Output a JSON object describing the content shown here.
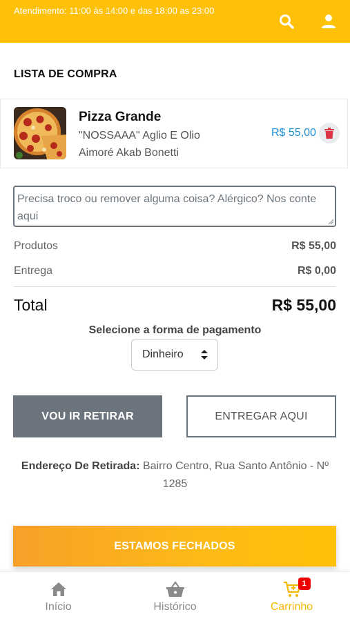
{
  "header": {
    "hours": "Atendimento: 11:00 às 14:00 e das 18:00 as 23:00",
    "search_icon": "search-icon",
    "user_icon": "user-icon",
    "bg_color": "#ffc107"
  },
  "cart": {
    "title": "LISTA DE COMPRA",
    "items": [
      {
        "name": "Pizza Grande",
        "description": "\"NOSSAAA\" Aglio E Olio Aimoré Akab Bonetti",
        "price": "R$ 55,00",
        "image": "pizza-thumbnail",
        "delete_icon": "trash-icon"
      }
    ]
  },
  "notes": {
    "placeholder": "Precisa troco ou remover alguma coisa? Alérgico? Nos conte aqui"
  },
  "summary": {
    "products_label": "Produtos",
    "products_value": "R$ 55,00",
    "delivery_label": "Entrega",
    "delivery_value": "R$ 0,00",
    "total_label": "Total",
    "total_value": "R$ 55,00"
  },
  "payment": {
    "label": "Selecione a forma de pagamento",
    "selected": "Dinheiro"
  },
  "mode": {
    "pickup_label": "VOU IR RETIRAR",
    "delivery_label": "ENTREGAR AQUI"
  },
  "pickup_address": {
    "label": "Endereço De Retirada:",
    "value": "Bairro Centro, Rua Santo Antônio - Nº 1285"
  },
  "status_button": {
    "label": "ESTAMOS FECHADOS"
  },
  "bottom_nav": {
    "items": [
      {
        "label": "Início",
        "icon": "home-icon"
      },
      {
        "label": "Histórico",
        "icon": "basket-icon"
      },
      {
        "label": "Carrinho",
        "icon": "cart-icon",
        "badge": "1",
        "active": true
      }
    ],
    "accent_color": "#f5b800"
  }
}
